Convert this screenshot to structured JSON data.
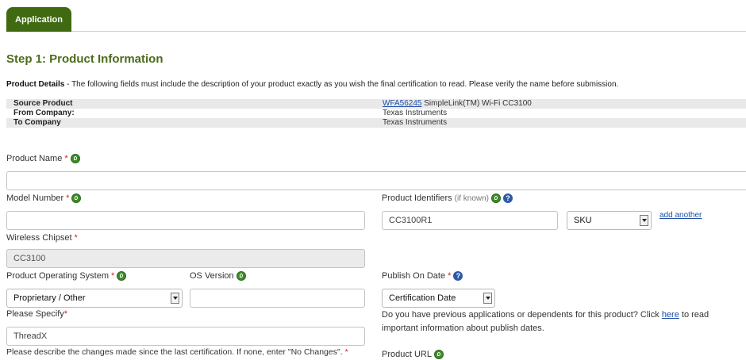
{
  "tabs": {
    "active": "Application"
  },
  "step_title": "Step 1: Product Information",
  "product_details": {
    "label": "Product Details",
    "text": " - The following fields must include the description of your product exactly as you wish the final certification to read. Please verify the name before submission."
  },
  "info_rows": [
    {
      "key": "Source Product",
      "link": "WFA56245",
      "value": " SimpleLink(TM) Wi-Fi CC3100"
    },
    {
      "key": "From Company:",
      "value": "Texas Instruments"
    },
    {
      "key": "To Company",
      "value": "Texas Instruments"
    }
  ],
  "fields": {
    "product_name": {
      "label": "Product Name",
      "required": "*",
      "value": ""
    },
    "model_number": {
      "label": "Model Number",
      "required": "*",
      "value": ""
    },
    "product_identifiers": {
      "label": "Product Identifiers",
      "sub": "(if known)",
      "value": "CC3100R1",
      "type": "SKU",
      "add_another": "add another"
    },
    "wireless_chipset": {
      "label": "Wireless Chipset",
      "required": "*",
      "value": "CC3100"
    },
    "product_os": {
      "label": "Product Operating System",
      "required": "*",
      "value": "Proprietary / Other"
    },
    "os_version": {
      "label": "OS Version",
      "value": ""
    },
    "publish_on_date": {
      "label": "Publish On Date",
      "required": "*",
      "value": "Certification Date"
    },
    "please_specify": {
      "label": "Please Specify",
      "required": "*",
      "value": "ThreadX"
    },
    "changes": {
      "label": "Please describe the changes made since the last certification. If none, enter \"No Changes\".",
      "required": "*"
    },
    "product_url": {
      "label": "Product URL"
    }
  },
  "publish_note": {
    "before": "Do you have previous applications or dependents for this product? Click ",
    "link": "here",
    "after": " to read important information about publish dates."
  }
}
